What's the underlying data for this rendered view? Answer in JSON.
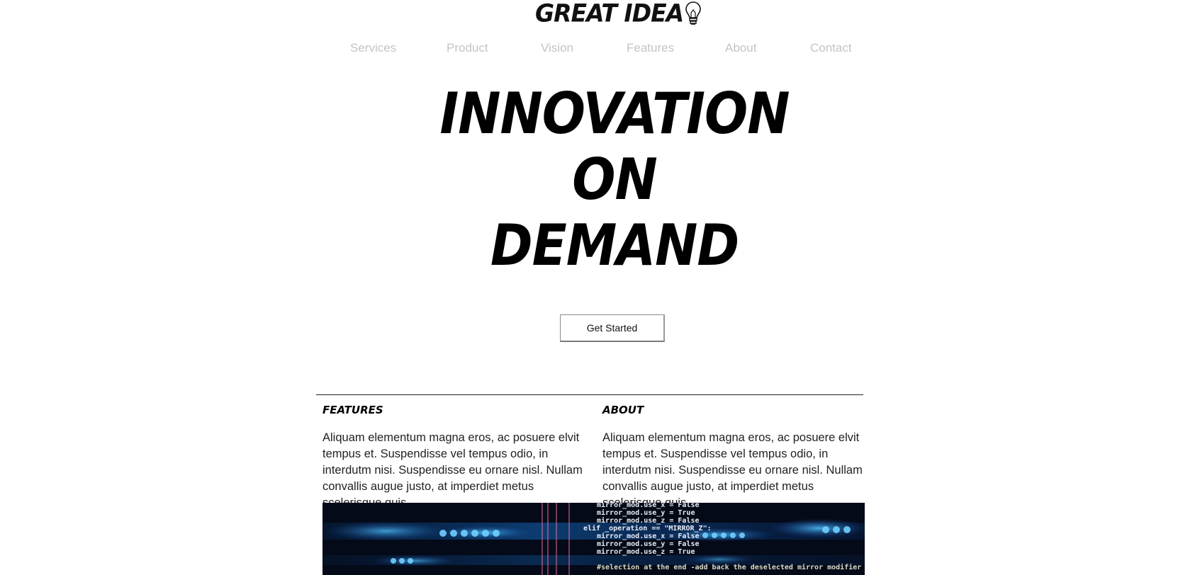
{
  "brand": {
    "name": "GREAT IDEA",
    "logo_icon": "lightbulb-icon"
  },
  "nav": {
    "items": [
      {
        "label": "Services"
      },
      {
        "label": "Product"
      },
      {
        "label": "Vision"
      },
      {
        "label": "Features"
      },
      {
        "label": "About"
      },
      {
        "label": "Contact"
      }
    ]
  },
  "hero": {
    "lines": [
      "INNOVATION",
      "ON",
      "DEMAND"
    ],
    "cta_label": "Get Started"
  },
  "sections": [
    {
      "title": "FEATURES",
      "body": "Aliquam elementum magna eros, ac posuere elvit tempus et. Suspendisse vel tempus odio, in interdutm nisi. Suspendisse eu ornare nisl. Nullam convallis augue justo, at imperdiet metus scelerisque quis."
    },
    {
      "title": "ABOUT",
      "body": "Aliquam elementum magna eros, ac posuere elvit tempus et. Suspendisse vel tempus odio, in interdutm nisi. Suspendisse eu ornare nisl. Nullam convallis augue justo, at imperdiet metus scelerisque quis."
    }
  ],
  "code_image": {
    "lines": [
      "mirror_mod.use_x = False",
      "mirror_mod.use_y = True",
      "mirror_mod.use_z = False",
      "elif _operation == \"MIRROR_Z\":",
      "mirror_mod.use_x = False",
      "mirror_mod.use_y = False",
      "mirror_mod.use_z = True",
      "#selection at the end -add back the deselected mirror modifier object"
    ],
    "colors": {
      "background": "#050a18",
      "glow": "#1f8fff",
      "text": "#e8ecf4"
    }
  },
  "colors": {
    "nav_text": "#c4c4c4",
    "heading": "#000000",
    "body_text": "#222222"
  }
}
